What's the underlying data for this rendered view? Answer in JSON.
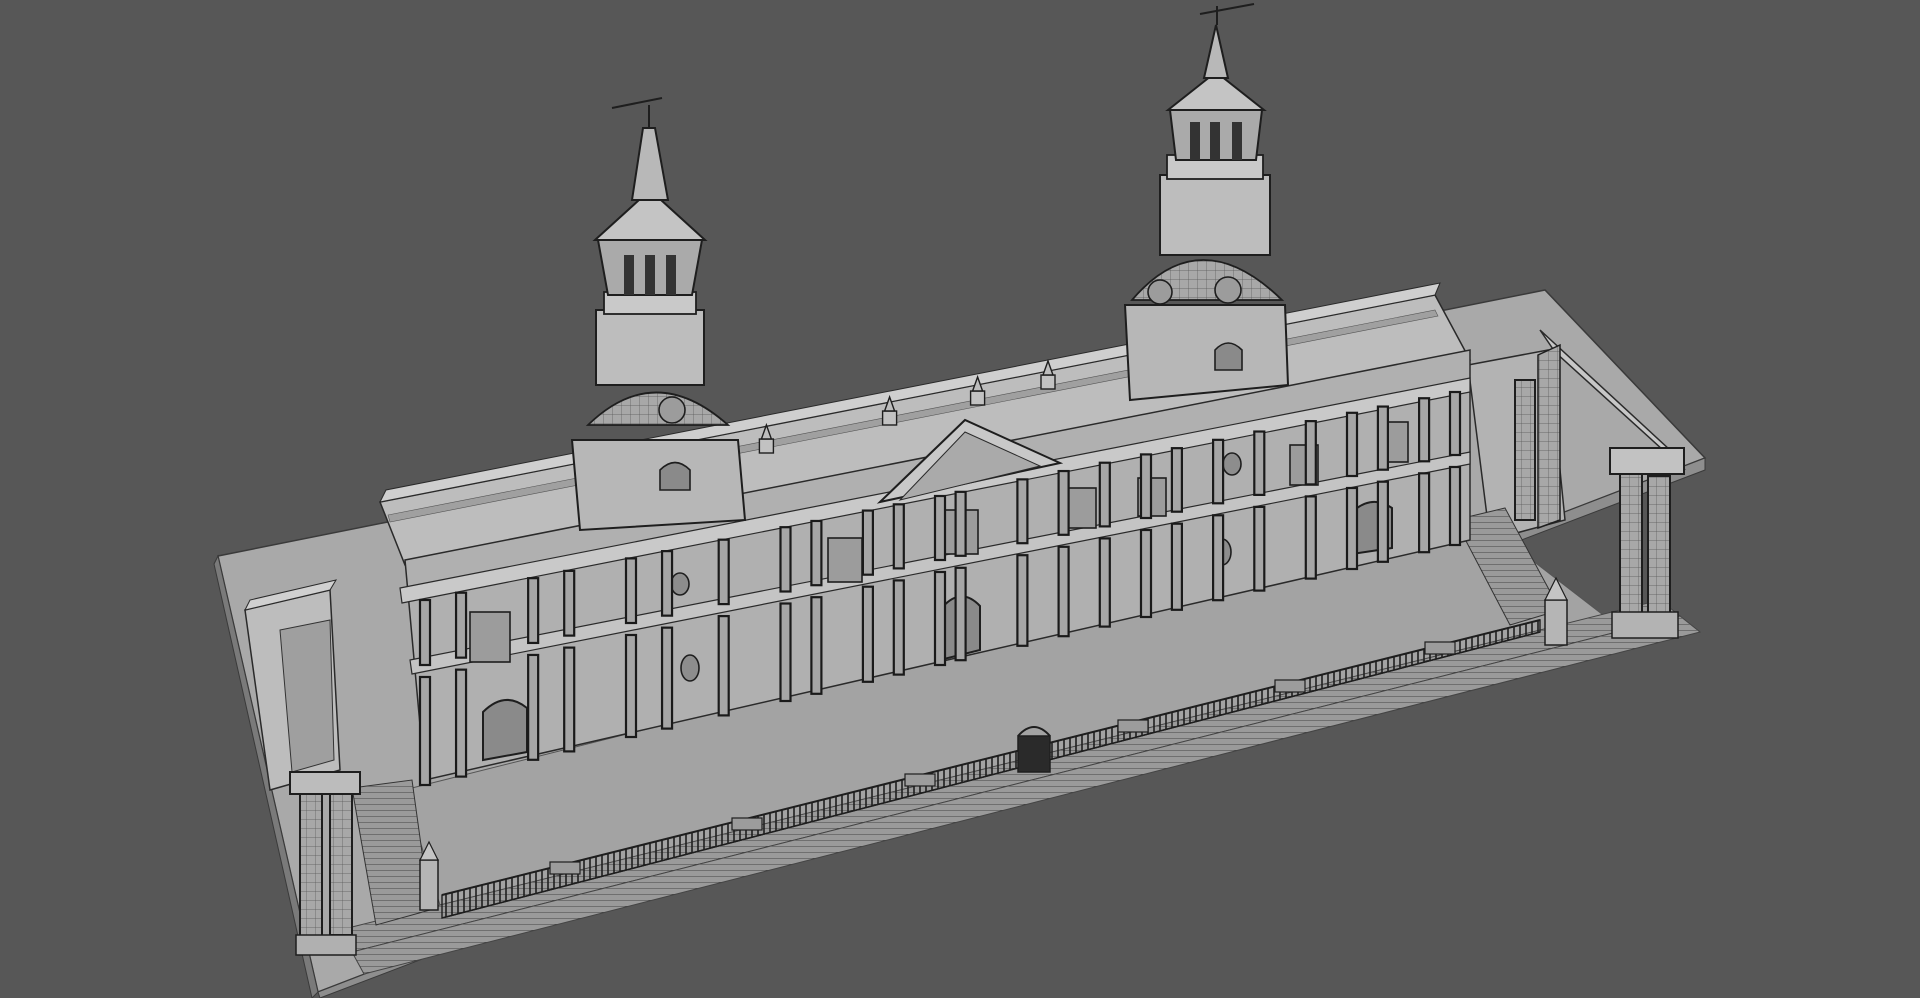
{
  "viewport": {
    "background_color": "#575757",
    "render_style": "shaded-with-wireframe",
    "model": "cathedral",
    "model_color": "#b7b7b7",
    "wire_color": "#1e1e1e"
  }
}
